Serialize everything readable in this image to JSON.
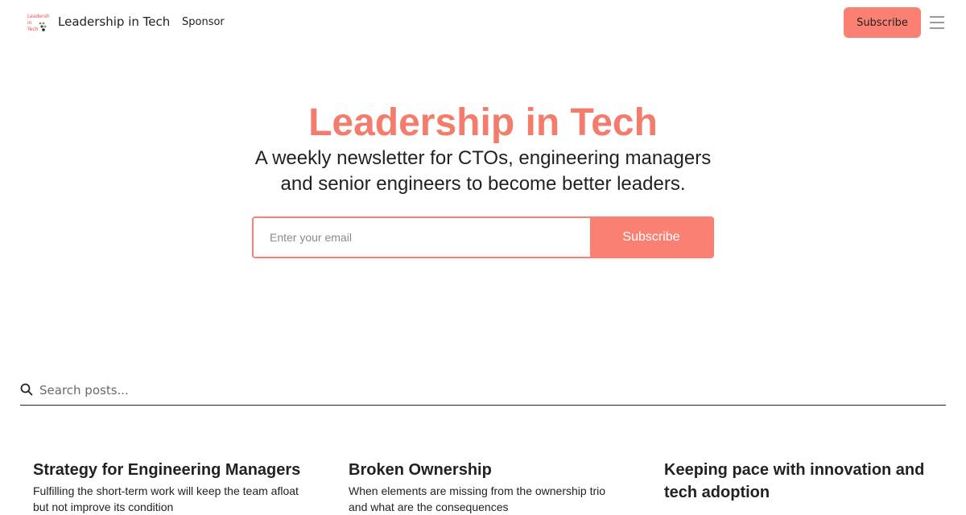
{
  "header": {
    "logo_text": "Leadership in Tech",
    "site_name": "Leadership in Tech",
    "nav": [
      {
        "label": "Sponsor"
      }
    ],
    "subscribe_label": "Subscribe",
    "menu_icon": "hamburger-menu-icon"
  },
  "hero": {
    "title": "Leadership in Tech",
    "subtitle": "A weekly newsletter for CTOs, engineering managers and senior engineers to become better leaders.",
    "email_placeholder": "Enter your email",
    "subscribe_label": "Subscribe"
  },
  "search": {
    "placeholder": "Search posts...",
    "icon": "search-icon"
  },
  "posts": [
    {
      "title": "Strategy for Engineering Managers",
      "excerpt": "Fulfilling the short-term work will keep the team afloat but not improve its condition"
    },
    {
      "title": "Broken Ownership",
      "excerpt": "When elements are missing from the ownership trio and what are the consequences"
    },
    {
      "title": "Keeping pace with innovation and tech adoption",
      "excerpt": ""
    }
  ],
  "colors": {
    "accent": "#f98072",
    "title": "#f47c6c",
    "text": "#222222"
  }
}
